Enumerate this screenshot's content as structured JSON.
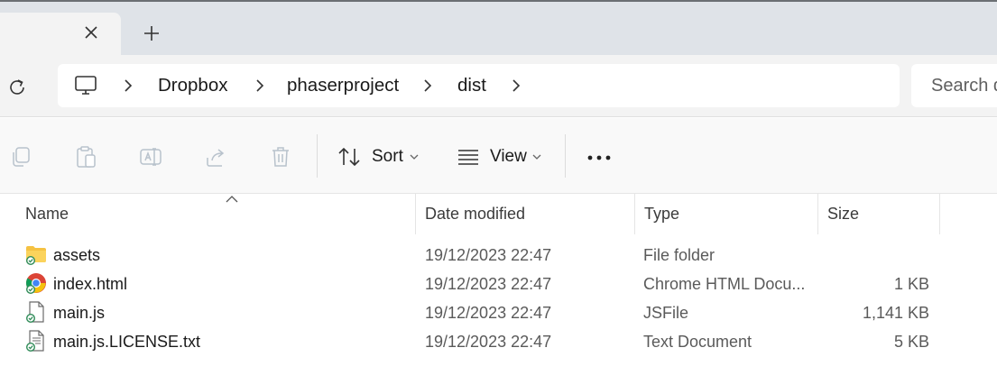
{
  "tabs": {
    "close_icon": "close-icon",
    "new_tab_icon": "plus-icon"
  },
  "address": {
    "root_icon": "this-pc-icon",
    "crumbs": [
      "Dropbox",
      "phaserproject",
      "dist"
    ]
  },
  "search": {
    "placeholder": "Search d"
  },
  "toolbar": {
    "sort_label": "Sort",
    "view_label": "View",
    "icons": [
      "copy-icon",
      "paste-icon",
      "rename-icon",
      "share-icon",
      "delete-icon",
      "more-icon"
    ]
  },
  "columns": {
    "name": "Name",
    "date": "Date modified",
    "type": "Type",
    "size": "Size"
  },
  "files": [
    {
      "name": "assets",
      "date": "19/12/2023 22:47",
      "type": "File folder",
      "size": "",
      "icon": "folder-icon"
    },
    {
      "name": "index.html",
      "date": "19/12/2023 22:47",
      "type": "Chrome HTML Docu...",
      "size": "1 KB",
      "icon": "chrome-icon"
    },
    {
      "name": "main.js",
      "date": "19/12/2023 22:47",
      "type": "JSFile",
      "size": "1,141 KB",
      "icon": "file-icon"
    },
    {
      "name": "main.js.LICENSE.txt",
      "date": "19/12/2023 22:47",
      "type": "Text Document",
      "size": "5 KB",
      "icon": "text-file-icon"
    }
  ],
  "colors": {
    "tabstrip": "#dfe3e8",
    "sync_check": "#2e8b57",
    "folder": "#f5c242"
  }
}
